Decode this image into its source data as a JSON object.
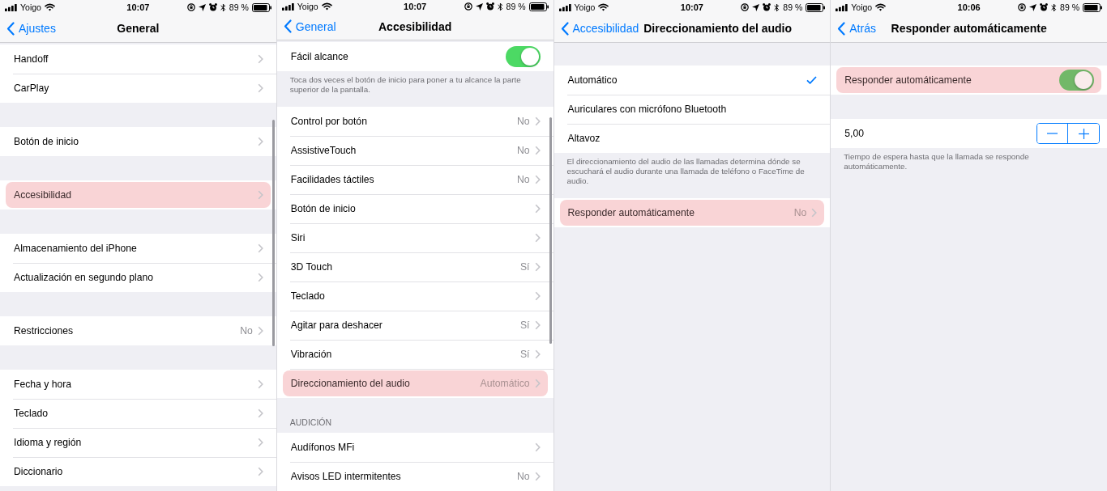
{
  "screens": [
    {
      "status_bar": {
        "carrier": "Yoigo",
        "time": "10:07",
        "battery": "89 %"
      },
      "nav": {
        "back": "Ajustes",
        "title": "General"
      },
      "scroll_indicator": true,
      "sections": [
        {
          "rows": [
            {
              "kind": "link",
              "label": "Handoff",
              "highlighted": false
            },
            {
              "kind": "link",
              "label": "CarPlay",
              "highlighted": false
            }
          ]
        },
        {
          "rows": [
            {
              "kind": "link",
              "label": "Botón de inicio",
              "highlighted": false
            }
          ]
        },
        {
          "rows": [
            {
              "kind": "link",
              "label": "Accesibilidad",
              "highlighted": true
            }
          ]
        },
        {
          "rows": [
            {
              "kind": "link",
              "label": "Almacenamiento del iPhone",
              "highlighted": false
            },
            {
              "kind": "link",
              "label": "Actualización en segundo plano",
              "highlighted": false
            }
          ]
        },
        {
          "rows": [
            {
              "kind": "link",
              "label": "Restricciones",
              "value": "No",
              "highlighted": false
            }
          ]
        },
        {
          "rows": [
            {
              "kind": "link",
              "label": "Fecha y hora",
              "highlighted": false
            },
            {
              "kind": "link",
              "label": "Teclado",
              "highlighted": false
            },
            {
              "kind": "link",
              "label": "Idioma y región",
              "highlighted": false
            },
            {
              "kind": "link",
              "label": "Diccionario",
              "highlighted": false
            }
          ]
        }
      ]
    },
    {
      "status_bar": {
        "carrier": "Yoigo",
        "time": "10:07",
        "battery": "89 %"
      },
      "nav": {
        "back": "General",
        "title": "Accesibilidad"
      },
      "scroll_indicator": true,
      "sections": [
        {
          "rows": [
            {
              "kind": "toggle",
              "label": "Fácil alcance",
              "on": true,
              "highlighted": false
            }
          ],
          "footer": "Toca dos veces el botón de inicio para poner a tu alcance la parte superior de la pantalla."
        },
        {
          "rows": [
            {
              "kind": "link",
              "label": "Control por botón",
              "value": "No",
              "highlighted": false
            },
            {
              "kind": "link",
              "label": "AssistiveTouch",
              "value": "No",
              "highlighted": false
            },
            {
              "kind": "link",
              "label": "Facilidades táctiles",
              "value": "No",
              "highlighted": false
            },
            {
              "kind": "link",
              "label": "Botón de inicio",
              "highlighted": false
            },
            {
              "kind": "link",
              "label": "Siri",
              "highlighted": false
            },
            {
              "kind": "link",
              "label": "3D Touch",
              "value": "Sí",
              "highlighted": false
            },
            {
              "kind": "link",
              "label": "Teclado",
              "highlighted": false
            },
            {
              "kind": "link",
              "label": "Agitar para deshacer",
              "value": "Sí",
              "highlighted": false
            },
            {
              "kind": "link",
              "label": "Vibración",
              "value": "Sí",
              "highlighted": false
            },
            {
              "kind": "link",
              "label": "Direccionamiento del audio",
              "value": "Automático",
              "highlighted": true
            }
          ]
        },
        {
          "header": "AUDICIÓN",
          "rows": [
            {
              "kind": "link",
              "label": "Audífonos MFi",
              "highlighted": false
            },
            {
              "kind": "link",
              "label": "Avisos LED intermitentes",
              "value": "No",
              "highlighted": false
            }
          ]
        }
      ]
    },
    {
      "status_bar": {
        "carrier": "Yoigo",
        "time": "10:07",
        "battery": "89 %"
      },
      "nav": {
        "back": "Accesibilidad",
        "title": "Direccionamiento del audio"
      },
      "sections": [
        {
          "rows": [
            {
              "kind": "check",
              "label": "Automático",
              "checked": true,
              "highlighted": false
            },
            {
              "kind": "check",
              "label": "Auriculares con micrófono Bluetooth",
              "checked": false,
              "highlighted": false
            },
            {
              "kind": "check",
              "label": "Altavoz",
              "checked": false,
              "highlighted": false
            }
          ],
          "footer": "El direccionamiento del audio de las llamadas determina dónde se escuchará el audio durante una llamada de teléfono o FaceTime de audio."
        },
        {
          "rows": [
            {
              "kind": "link",
              "label": "Responder automáticamente",
              "value": "No",
              "highlighted": true
            }
          ]
        }
      ]
    },
    {
      "status_bar": {
        "carrier": "Yoigo",
        "time": "10:06",
        "battery": "89 %"
      },
      "nav": {
        "back": "Atrás",
        "title": "Responder automáticamente"
      },
      "sections": [
        {
          "rows": [
            {
              "kind": "toggle",
              "label": "Responder automáticamente",
              "on": true,
              "highlighted": true
            }
          ]
        },
        {
          "rows": [
            {
              "kind": "stepper",
              "label": "5,00",
              "highlighted": false
            }
          ],
          "footer": "Tiempo de espera hasta que la llamada se responde automáticamente."
        }
      ]
    }
  ]
}
